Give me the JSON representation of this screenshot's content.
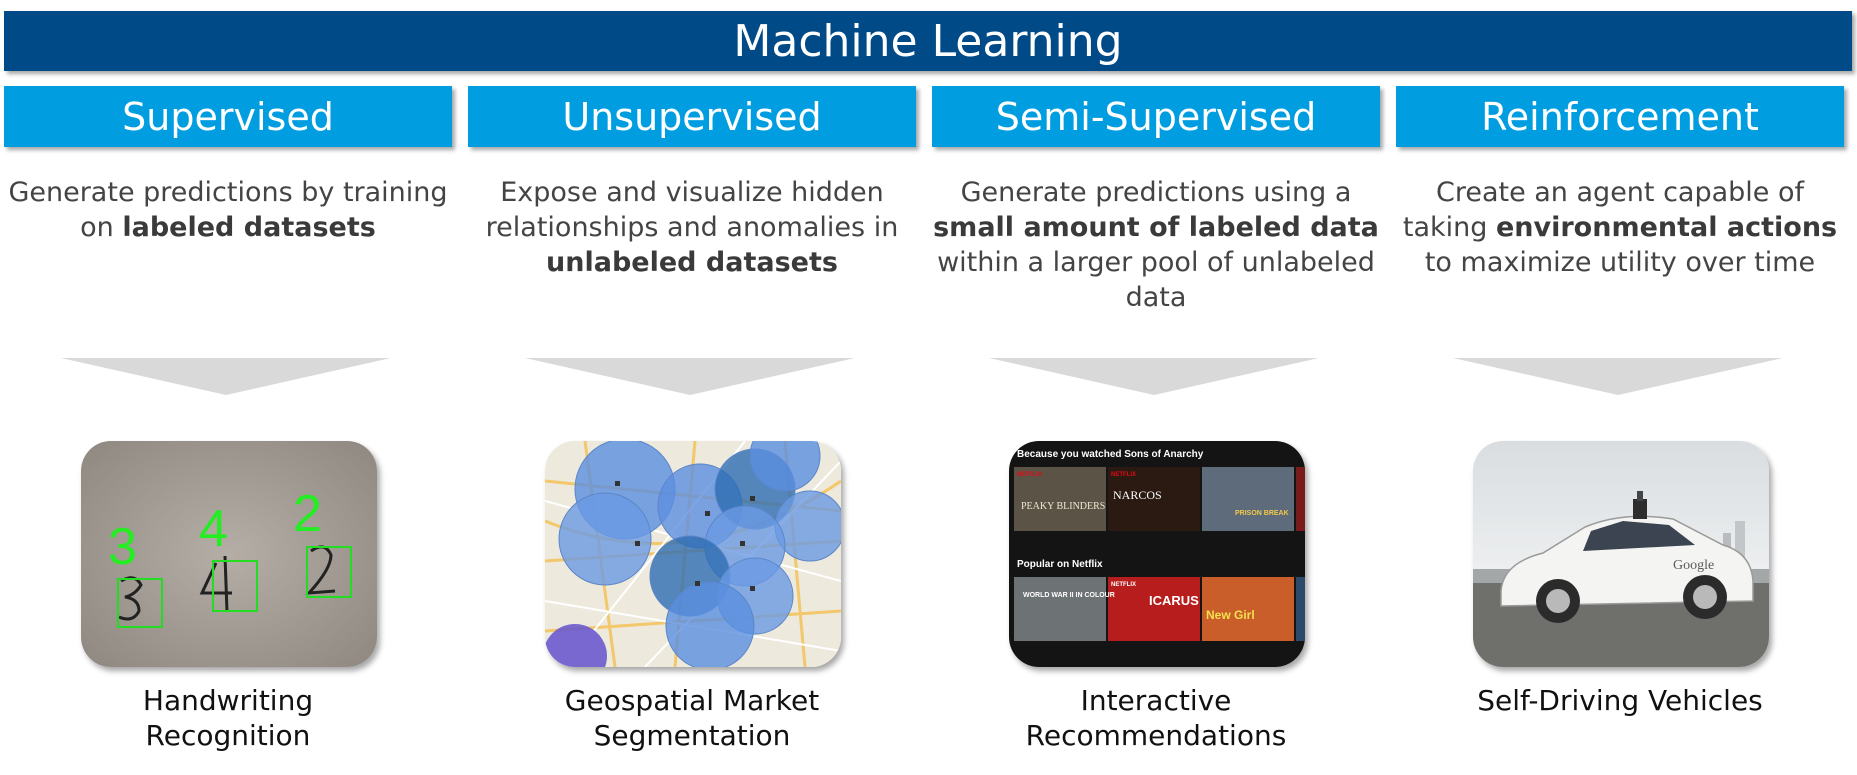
{
  "title": "Machine Learning",
  "columns": [
    {
      "header": "Supervised",
      "desc": [
        {
          "t": "Generate predictions by training on ",
          "b": false
        },
        {
          "t": "labeled datasets",
          "b": true
        }
      ],
      "caption_lines": [
        "Handwriting",
        "Recognition"
      ],
      "image": {
        "digits": [
          "3",
          "4",
          "2"
        ]
      }
    },
    {
      "header": "Unsupervised",
      "desc": [
        {
          "t": "Expose and visualize hidden relationships and anomalies in ",
          "b": false
        },
        {
          "t": "unlabeled datasets",
          "b": true
        }
      ],
      "caption_lines": [
        "Geospatial Market",
        "Segmentation"
      ],
      "image": {}
    },
    {
      "header": "Semi-Supervised",
      "desc": [
        {
          "t": "Generate predictions using a ",
          "b": false
        },
        {
          "t": "small amount of labeled data",
          "b": true
        },
        {
          "t": " within a larger pool of unlabeled data",
          "b": false
        }
      ],
      "caption_lines": [
        "Interactive",
        "Recommendations"
      ],
      "image": {
        "row1_label": "Because you watched Sons of Anarchy",
        "row2_label": "Popular on Netflix",
        "brand": "NETFLIX",
        "titles": [
          "PEAKY BLINDERS",
          "NARCOS",
          "PRISON BREAK",
          "WORLD WAR II IN COLOUR",
          "ICARUS",
          "New Girl"
        ]
      }
    },
    {
      "header": "Reinforcement",
      "desc": [
        {
          "t": "Create an agent capable of taking ",
          "b": false
        },
        {
          "t": "environmental actions",
          "b": true
        },
        {
          "t": " to maximize utility over time",
          "b": false
        }
      ],
      "caption_lines": [
        "Self-Driving Vehicles"
      ],
      "image": {
        "logo": "Google"
      }
    }
  ]
}
